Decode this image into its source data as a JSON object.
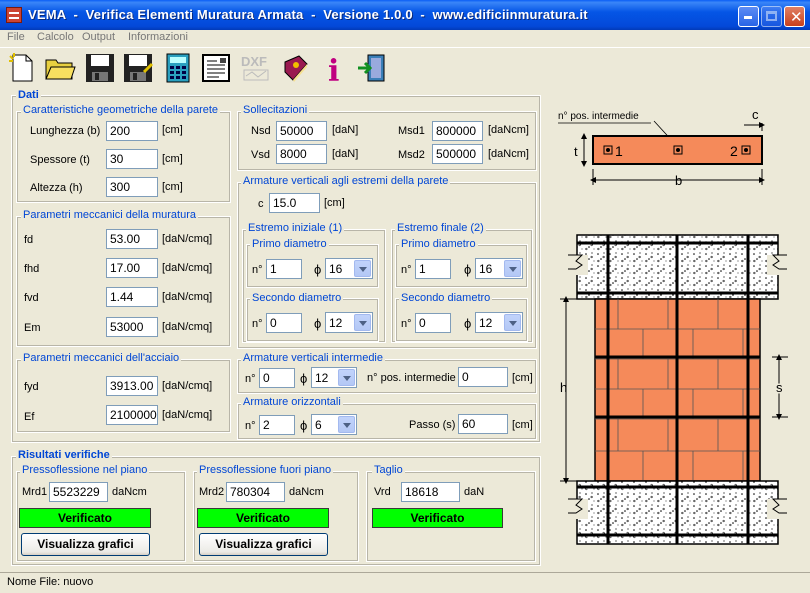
{
  "window": {
    "title": "VEMA  -  Verifica Elementi Muratura Armata  -  Versione 1.0.0  -  www.edificiinmuratura.it"
  },
  "menu": [
    "File",
    "Calcolo",
    "Output",
    "Informazioni"
  ],
  "toolbar": [
    "new-file-icon",
    "open-folder-icon",
    "save-icon",
    "save-as-icon",
    "calculator-icon",
    "report-icon",
    "dxf-export-icon",
    "help-book-icon",
    "info-icon",
    "exit-icon"
  ],
  "toolbar_dxf_text": "DXF",
  "toolbar_info_text": "i",
  "dati": {
    "title": "Dati",
    "geometria": {
      "title": "Caratteristiche geometriche della parete",
      "lunghezza": {
        "label": "Lunghezza (b)",
        "value": "200",
        "unit": "[cm]"
      },
      "spessore": {
        "label": "Spessore (t)",
        "value": "30",
        "unit": "[cm]"
      },
      "altezza": {
        "label": "Altezza (h)",
        "value": "300",
        "unit": "[cm]"
      }
    },
    "muratura": {
      "title": "Parametri meccanici della muratura",
      "fd": {
        "label": "fd",
        "value": "53.00",
        "unit": "[daN/cmq]"
      },
      "fhd": {
        "label": "fhd",
        "value": "17.00",
        "unit": "[daN/cmq]"
      },
      "fvd": {
        "label": "fvd",
        "value": "1.44",
        "unit": "[daN/cmq]"
      },
      "em": {
        "label": "Em",
        "value": "53000",
        "unit": "[daN/cmq]"
      }
    },
    "acciaio": {
      "title": "Parametri meccanici dell'acciaio",
      "fyd": {
        "label": "fyd",
        "value": "3913.00",
        "unit": "[daN/cmq]"
      },
      "ef": {
        "label": "Ef",
        "value": "2100000",
        "unit": "[daN/cmq]"
      }
    },
    "sollecitazioni": {
      "title": "Sollecitazioni",
      "nsd": {
        "label": "Nsd",
        "value": "50000",
        "unit": "[daN]"
      },
      "vsd": {
        "label": "Vsd",
        "value": "8000",
        "unit": "[daN]"
      },
      "msd1": {
        "label": "Msd1",
        "value": "800000",
        "unit": "[daNcm]"
      },
      "msd2": {
        "label": "Msd2",
        "value": "500000",
        "unit": "[daNcm]"
      }
    },
    "armature_estremi": {
      "title": "Armature verticali agli estremi della parete",
      "c": {
        "label": "c",
        "value": "15.0",
        "unit": "[cm]"
      },
      "iniziale": {
        "title": "Estremo iniziale (1)",
        "primo": {
          "title": "Primo diametro",
          "n_label": "n°",
          "n": "1",
          "phi_label": "ϕ",
          "phi": "16"
        },
        "secondo": {
          "title": "Secondo diametro",
          "n_label": "n°",
          "n": "0",
          "phi_label": "ϕ",
          "phi": "12"
        }
      },
      "finale": {
        "title": "Estremo finale (2)",
        "primo": {
          "title": "Primo diametro",
          "n_label": "n°",
          "n": "1",
          "phi_label": "ϕ",
          "phi": "16"
        },
        "secondo": {
          "title": "Secondo diametro",
          "n_label": "n°",
          "n": "0",
          "phi_label": "ϕ",
          "phi": "12"
        }
      }
    },
    "armature_intermedie": {
      "title": "Armature verticali intermedie",
      "n_label": "n°",
      "n": "0",
      "phi_label": "ϕ",
      "phi": "12",
      "pos_label": "n° pos. intermedie",
      "pos": "0",
      "unit": "[cm]"
    },
    "armature_orizzontali": {
      "title": "Armature orizzontali",
      "n_label": "n°",
      "n": "2",
      "phi_label": "ϕ",
      "phi": "6",
      "passo_label": "Passo (s)",
      "passo": "60",
      "unit": "[cm]"
    }
  },
  "risultati": {
    "title": "Risultati verifiche",
    "piano": {
      "title": "Pressoflessione nel piano",
      "label": "Mrd1",
      "value": "5523229",
      "unit": "daNcm",
      "status": "Verificato",
      "button": "Visualizza grafici"
    },
    "fuori": {
      "title": "Pressoflessione fuori piano",
      "label": "Mrd2",
      "value": "780304",
      "unit": "daNcm",
      "status": "Verificato",
      "button": "Visualizza grafici"
    },
    "taglio": {
      "title": "Taglio",
      "label": "Vrd",
      "value": "18618",
      "unit": "daN",
      "status": "Verificato"
    }
  },
  "diagram": {
    "pos_intermedie": "n° pos. intermedie",
    "c": "c",
    "t": "t",
    "b": "b",
    "h": "h",
    "s": "s",
    "one": "1",
    "two": "2"
  },
  "status": {
    "file_label": "Nome File: nuovo"
  },
  "colors": {
    "brick": "#f58a5a",
    "status_ok": "#00ff00",
    "group_title": "#0046d5"
  }
}
